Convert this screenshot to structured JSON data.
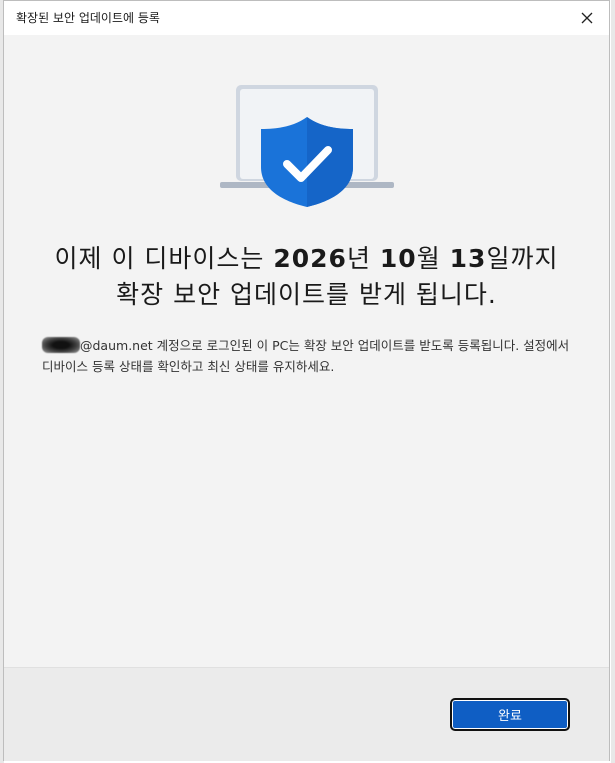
{
  "window": {
    "title": "확장된 보안 업데이트에 등록",
    "close_icon": "close-icon"
  },
  "illustration": {
    "icon": "laptop-shield-check-icon",
    "colors": {
      "shield": "#1a73d9",
      "laptop": "#cfd6e0",
      "check": "#ffffff"
    }
  },
  "headline": {
    "part1": "이제 이 디바이스는 ",
    "year": "2026",
    "part2": "년 ",
    "month": "10",
    "part3": "월 ",
    "day": "13",
    "part4": "일까지",
    "line2": "확장 보안 업데이트를 받게 됩니다."
  },
  "description": {
    "email_suffix": "@daum.net",
    "text": " 계정으로 로그인된 이 PC는 확장 보안 업데이트를 받도록 등록됩니다. 설정에서 디바이스 등록 상태를 확인하고 최신 상태를 유지하세요."
  },
  "footer": {
    "done_label": "완료",
    "accent": "#0f5ec4"
  }
}
